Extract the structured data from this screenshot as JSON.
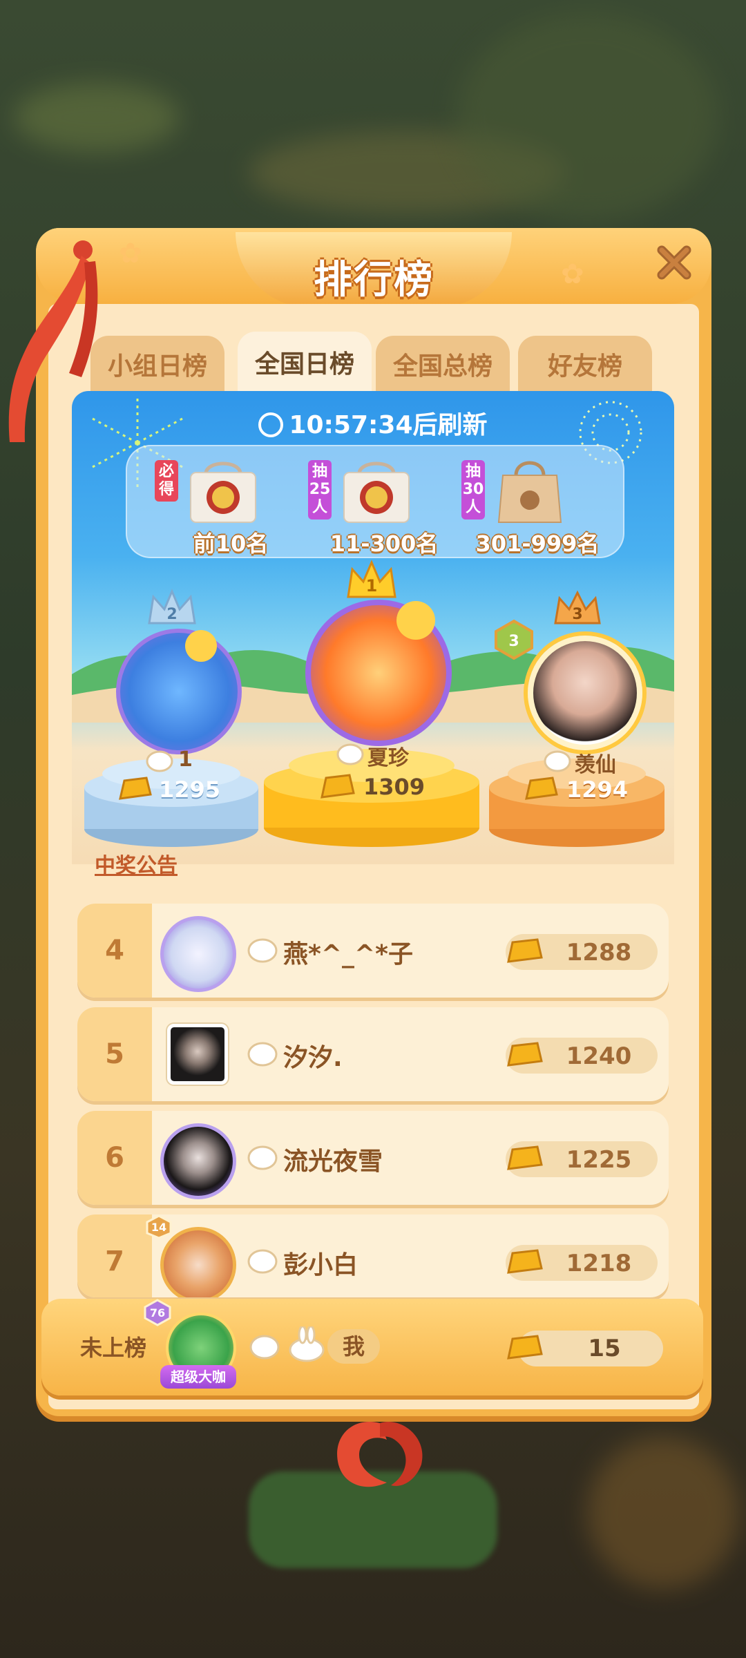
{
  "panel": {
    "title": "排行榜"
  },
  "tabs": [
    {
      "label": "小组日榜",
      "active": false
    },
    {
      "label": "全国日榜",
      "active": true
    },
    {
      "label": "全国总榜",
      "active": false
    },
    {
      "label": "好友榜",
      "active": false
    }
  ],
  "refresh": {
    "time": "10:57:34",
    "suffix": "后刷新"
  },
  "prizes": [
    {
      "tag": "必得",
      "range": "前10名"
    },
    {
      "tag": "抽25人",
      "range": "11-300名"
    },
    {
      "tag": "抽30人",
      "range": "301-999名"
    }
  ],
  "podium": [
    {
      "rank": "1",
      "name": "夏珍",
      "score": "1309"
    },
    {
      "rank": "2",
      "name": "1",
      "score": "1295"
    },
    {
      "rank": "3",
      "name": "羡仙",
      "score": "1294",
      "level": "3"
    }
  ],
  "announcement": "中奖公告",
  "list": [
    {
      "rank": "4",
      "name": "燕*^_^*子",
      "score": "1288"
    },
    {
      "rank": "5",
      "name": "汐汐.",
      "score": "1240"
    },
    {
      "rank": "6",
      "name": "流光夜雪",
      "score": "1225"
    },
    {
      "rank": "7",
      "name": "彭小白",
      "score": "1218",
      "level": "14"
    }
  ],
  "me": {
    "status": "未上榜",
    "level": "76",
    "title_badge": "超级大咖",
    "name": "我",
    "score": "15"
  },
  "colors": {
    "panel": "#f6b54a",
    "gold": "#f5b31c",
    "stage_blue": "#2f96ea",
    "rank_text": "#bf7a35"
  }
}
